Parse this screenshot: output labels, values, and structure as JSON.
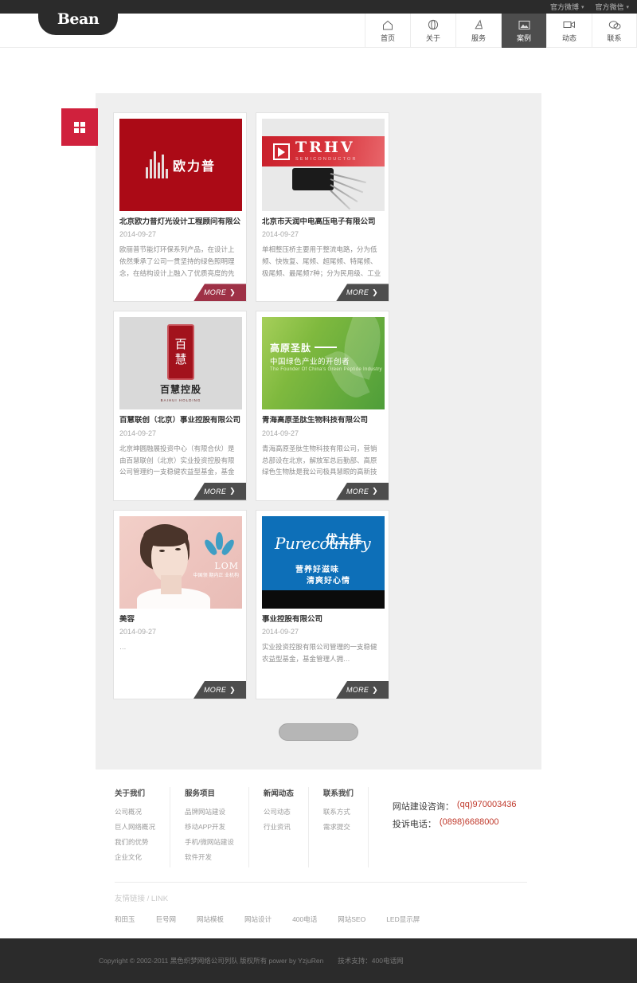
{
  "topbar": {
    "items": [
      {
        "label": "官方微博",
        "icon": "chevron-down-icon"
      },
      {
        "label": "官方微信",
        "icon": "chevron-down-icon"
      }
    ]
  },
  "header": {
    "logo": "Bean",
    "nav": [
      {
        "label": "首页",
        "icon": "home-icon",
        "active": false
      },
      {
        "label": "关于",
        "icon": "info-circle-icon",
        "active": false
      },
      {
        "label": "服务",
        "icon": "pen-icon",
        "active": false
      },
      {
        "label": "案例",
        "icon": "image-icon",
        "active": true
      },
      {
        "label": "动态",
        "icon": "video-icon",
        "active": false
      },
      {
        "label": "联系",
        "icon": "chat-icon",
        "active": false
      }
    ]
  },
  "section": {
    "badge_icon": "grid-icon"
  },
  "cards": [
    {
      "title": "北京欧力普灯光设计工程顾问有限公司",
      "date": "2014-09-27",
      "desc": "欧丽普节能灯环保系列产品，在设计上依然秉承了公司一贯坚持的绿色照明理念，在结构设计上融入了优质亮度的先进技术…",
      "more": "MORE",
      "more_style": "red",
      "art": "oulipu",
      "art_text": {
        "cn": "欧力普"
      }
    },
    {
      "title": "北京市天润中电高压电子有限公司",
      "date": "2014-09-27",
      "desc": "单相整压桥主要用于整流电路，分为低频、快恢复、尾频、超尾频、特尾频、极尾频、最尾频7种；分为民用级、工业级和…",
      "more": "MORE",
      "more_style": "dark",
      "art": "trhv",
      "art_text": {
        "brand": "TRHV",
        "sub": "SEMICONDUCTOR"
      }
    },
    {
      "title": "百慧联创（北京）事业控股有限公司",
      "date": "2014-09-27",
      "desc": "北京坤圆融展投资中心（有限合伙）是由百慧联创（北京）实业投资控股有限公司管理约一支稳健农益型基金，基金管理人拥…",
      "more": "MORE",
      "more_style": "dark",
      "art": "baihui",
      "art_text": {
        "seal_top": "百",
        "seal_bottom": "慧",
        "cn": "百慧控股",
        "en": "BAIHUI HOLDING"
      }
    },
    {
      "title": "青海高原圣肽生物科技有限公司",
      "date": "2014-09-27",
      "desc": "青海高原圣肽生物科技有限公司，营销总部设在北京，解放军总后勤部、高原绿色生物肽是我公司极具慧眼的高新技术战略……",
      "more": "MORE",
      "more_style": "dark",
      "art": "green",
      "art_text": {
        "line1": "高原圣肽",
        "line2": "中国绿色产业的开创者",
        "line3": "The Founder Of  China’s Green Peptide Industry"
      }
    },
    {
      "title": "美容",
      "date": "2014-09-27",
      "desc": "…",
      "more": "MORE",
      "more_style": "dark",
      "art": "beauty",
      "art_text": {
        "brand": "LOM",
        "sub": "中国领\n期内正\n业机构"
      }
    },
    {
      "title": "事业控股有限公司",
      "date": "2014-09-27",
      "desc": "实业投资控股有限公司管理的一支稳健农益型基金，基金管理人拥…",
      "more": "MORE",
      "more_style": "dark",
      "art": "pure",
      "art_text": {
        "script": "Purecountry",
        "cn": "优土佳",
        "s1": "营养好滋味",
        "s2": "清爽好心情"
      }
    }
  ],
  "pager": {
    "label": ""
  },
  "footer": {
    "columns": [
      {
        "title": "关于我们",
        "links": [
          "公司概况",
          "巨人网络概况",
          "我们的优势",
          "企业文化"
        ]
      },
      {
        "title": "服务项目",
        "links": [
          "品牌网站建设",
          "移动APP开发",
          "手机/微网站建设",
          "软件开发"
        ]
      },
      {
        "title": "新闻动态",
        "links": [
          "公司动态",
          "行业资讯"
        ]
      },
      {
        "title": "联系我们",
        "links": [
          "联系方式",
          "需求提交"
        ]
      }
    ],
    "contact": [
      {
        "label": "网站建设咨询：",
        "value": "(qq)970003436"
      },
      {
        "label": "投诉电话：",
        "value": "(0898)6688000"
      }
    ],
    "links_title": "友情链接",
    "links_title_en": "/ LINK",
    "links": [
      "和田玉",
      "巨号网",
      "网站模板",
      "网站设计",
      "400电话",
      "网站SEO",
      "LED显示屏"
    ],
    "copyright": "Copyright © 2002-2011 黑色织梦网络公司列队 版权所有 power by YzjuRen",
    "support": "技术支持：400电话网"
  }
}
